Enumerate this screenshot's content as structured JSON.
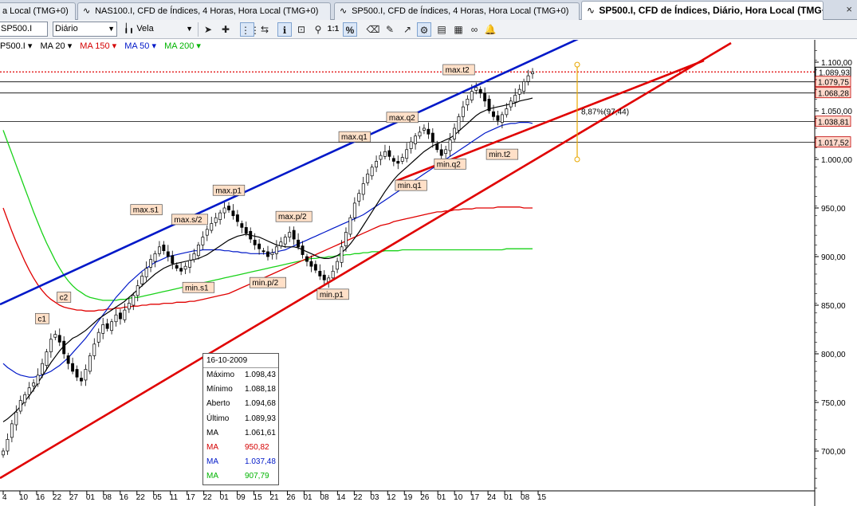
{
  "tabs": [
    {
      "label": "a Local (TMG+0)",
      "active": false
    },
    {
      "label": "NAS100.I, CFD de Índices, 4 Horas, Hora Local (TMG+0)",
      "active": false
    },
    {
      "label": "SP500.I, CFD de Índices, 4 Horas, Hora Local (TMG+0)",
      "active": false
    },
    {
      "label": "SP500.I, CFD de Índices, Diário, Hora Local (TMG+0)",
      "active": true
    }
  ],
  "close_glyph": "×",
  "toolbar": {
    "symbol": "SP500.I",
    "timeframe": "Diário",
    "chart_type": "Vela",
    "icons": [
      "cursor-icon",
      "crosshair-icon",
      "grid-icon",
      "auto-scroll-icon",
      "info-icon",
      "zoom-box-icon",
      "zoom-icon",
      "zoom-reset-icon",
      "percent-icon",
      "eraser-icon",
      "draw-icon",
      "magnet-icon",
      "indicator-icon",
      "template-icon",
      "link-icon",
      "alert-icon"
    ],
    "reset_label": "1:1",
    "percent_label": "%"
  },
  "indicators": [
    {
      "label": "P500.I ▾",
      "color": "#000000"
    },
    {
      "label": "MA 20 ▾",
      "color": "#000000"
    },
    {
      "label": "MA 150 ▾",
      "color": "#d40000"
    },
    {
      "label": "MA 50 ▾",
      "color": "#0018c8"
    },
    {
      "label": "MA 200 ▾",
      "color": "#00b400"
    }
  ],
  "colors": {
    "ma20": "#000000",
    "ma150": "#e00000",
    "ma50": "#0018c8",
    "ma200": "#19d219",
    "channel_top": "#0018c8",
    "channel_bottom": "#e00000",
    "candle_up": "#ffffff",
    "candle_down": "#000000",
    "price_tag_bg": "#ffd9cc",
    "price_tag_text": "#c00000",
    "annot_bg": "#ffe0c8",
    "measure": "#e8a800"
  },
  "chart_data": {
    "type": "candlestick",
    "title": "",
    "y_ticks": [
      "1.100,00",
      "1.050,00",
      "1.000,00",
      "950,00",
      "900,00",
      "850,00",
      "800,00",
      "750,00",
      "700,00"
    ],
    "y_tick_values": [
      1100,
      1050,
      1000,
      950,
      900,
      850,
      800,
      750,
      700
    ],
    "ylim": [
      662,
      1118
    ],
    "x_ticks": [
      "4",
      "10",
      "16",
      "22",
      "27",
      "01",
      "08",
      "16",
      "22",
      "05",
      "11",
      "17",
      "22",
      "01",
      "09",
      "15",
      "21",
      "26",
      "01",
      "08",
      "14",
      "22",
      "03",
      "12",
      "19",
      "26",
      "01",
      "10",
      "17",
      "24",
      "01",
      "08",
      "15"
    ],
    "price_levels": [
      {
        "value": 1089.93,
        "label": "1.089,93",
        "style": "dotted",
        "current": true
      },
      {
        "value": 1079.75,
        "label": "1.079,75"
      },
      {
        "value": 1068.28,
        "label": "1.068,28"
      },
      {
        "value": 1038.81,
        "label": "1.038,81"
      },
      {
        "value": 1017.52,
        "label": "1.017,52"
      }
    ],
    "annotations": [
      {
        "text": "c1",
        "x_index": 9,
        "value": 835
      },
      {
        "text": "c2",
        "x_index": 14,
        "value": 857
      },
      {
        "text": "max.s1",
        "x_index": 33,
        "value": 947
      },
      {
        "text": "max.s/2",
        "x_index": 43,
        "value": 937
      },
      {
        "text": "max.p1",
        "x_index": 52,
        "value": 967
      },
      {
        "text": "max.p/2",
        "x_index": 67,
        "value": 940
      },
      {
        "text": "min.s1",
        "x_index": 45,
        "value": 867
      },
      {
        "text": "min.p/2",
        "x_index": 61,
        "value": 872
      },
      {
        "text": "min.p1",
        "x_index": 76,
        "value": 860
      },
      {
        "text": "max.q1",
        "x_index": 81,
        "value": 1022
      },
      {
        "text": "max.q2",
        "x_index": 92,
        "value": 1042
      },
      {
        "text": "max.t2",
        "x_index": 105,
        "value": 1091
      },
      {
        "text": "min.q1",
        "x_index": 94,
        "value": 972
      },
      {
        "text": "min.q2",
        "x_index": 103,
        "value": 994
      },
      {
        "text": "min.t2",
        "x_index": 115,
        "value": 1004
      }
    ],
    "measure": {
      "label": "8,87%(97,44)",
      "from": 1000,
      "to": 1097.44
    },
    "candles_close": [
      700,
      712,
      728,
      740,
      752,
      758,
      765,
      770,
      778,
      790,
      802,
      815,
      820,
      812,
      800,
      790,
      782,
      776,
      772,
      784,
      798,
      810,
      822,
      830,
      826,
      833,
      840,
      836,
      845,
      852,
      860,
      870,
      880,
      888,
      897,
      903,
      910,
      906,
      900,
      893,
      888,
      885,
      890,
      896,
      903,
      912,
      920,
      928,
      934,
      940,
      945,
      950,
      948,
      942,
      936,
      930,
      924,
      918,
      912,
      908,
      905,
      900,
      904,
      910,
      915,
      920,
      925,
      918,
      910,
      902,
      895,
      890,
      886,
      880,
      876,
      878,
      885,
      895,
      910,
      925,
      940,
      955,
      965,
      975,
      985,
      992,
      998,
      1004,
      1008,
      1003,
      998,
      996,
      1002,
      1010,
      1018,
      1024,
      1028,
      1032,
      1026,
      1018,
      1010,
      1004,
      1010,
      1020,
      1032,
      1044,
      1054,
      1062,
      1070,
      1074,
      1068,
      1060,
      1050,
      1044,
      1040,
      1046,
      1052,
      1060,
      1066,
      1072,
      1080,
      1086,
      1090
    ],
    "ma20": [
      730,
      733,
      737,
      741,
      746,
      751,
      757,
      763,
      770,
      777,
      784,
      791,
      797,
      803,
      808,
      812,
      816,
      818,
      821,
      824,
      828,
      832,
      836,
      839,
      842,
      845,
      848,
      851,
      854,
      858,
      862,
      866,
      870,
      874,
      878,
      882,
      885,
      888,
      890,
      892,
      893,
      894,
      895,
      896,
      897,
      898,
      900,
      902,
      905,
      908,
      911,
      914,
      917,
      919,
      921,
      922,
      923,
      922,
      921,
      920,
      918,
      916,
      914,
      912,
      911,
      910,
      910,
      910,
      909,
      907,
      905,
      903,
      901,
      899,
      898,
      898,
      899,
      901,
      904,
      908,
      913,
      919,
      925,
      932,
      939,
      946,
      953,
      960,
      967,
      973,
      979,
      984,
      988,
      992,
      996,
      1000,
      1004,
      1008,
      1011,
      1014,
      1016,
      1018,
      1020,
      1022,
      1025,
      1029,
      1033,
      1037,
      1041,
      1045,
      1048,
      1050,
      1052,
      1053,
      1054,
      1055,
      1056,
      1057,
      1058,
      1060,
      1061,
      1062,
      1063
    ],
    "ma50": [
      790,
      786,
      783,
      780,
      778,
      777,
      776,
      776,
      777,
      778,
      780,
      782,
      785,
      788,
      792,
      796,
      801,
      806,
      811,
      816,
      822,
      828,
      834,
      840,
      846,
      852,
      858,
      863,
      868,
      873,
      877,
      881,
      885,
      888,
      891,
      894,
      896,
      898,
      900,
      901,
      902,
      903,
      904,
      905,
      906,
      906,
      907,
      907,
      907,
      907,
      907,
      906,
      906,
      905,
      905,
      904,
      904,
      903,
      903,
      903,
      903,
      903,
      904,
      905,
      906,
      907,
      909,
      911,
      913,
      915,
      917,
      919,
      921,
      923,
      925,
      927,
      929,
      931,
      933,
      935,
      937,
      939,
      941,
      943,
      946,
      949,
      952,
      955,
      958,
      961,
      964,
      967,
      970,
      973,
      976,
      979,
      982,
      985,
      988,
      991,
      994,
      997,
      1000,
      1003,
      1006,
      1009,
      1012,
      1015,
      1018,
      1021,
      1024,
      1027,
      1029,
      1031,
      1033,
      1035,
      1036,
      1037,
      1037,
      1038,
      1038,
      1038,
      1037
    ],
    "ma150": [
      950,
      938,
      926,
      915,
      905,
      895,
      886,
      878,
      871,
      865,
      860,
      856,
      853,
      850,
      848,
      847,
      846,
      845,
      845,
      844,
      844,
      844,
      845,
      845,
      846,
      846,
      847,
      847,
      848,
      848,
      849,
      849,
      850,
      850,
      851,
      851,
      851,
      852,
      852,
      852,
      853,
      853,
      853,
      854,
      854,
      855,
      856,
      857,
      858,
      859,
      860,
      861,
      862,
      864,
      866,
      868,
      870,
      872,
      874,
      876,
      878,
      880,
      882,
      884,
      886,
      888,
      890,
      892,
      894,
      896,
      898,
      900,
      902,
      904,
      906,
      908,
      910,
      912,
      914,
      916,
      918,
      920,
      922,
      924,
      926,
      928,
      930,
      932,
      933,
      934,
      936,
      937,
      938,
      939,
      940,
      941,
      942,
      943,
      944,
      945,
      946,
      946,
      947,
      947,
      948,
      948,
      949,
      949,
      949,
      950,
      950,
      950,
      950,
      950,
      951,
      951,
      951,
      951,
      951,
      951,
      950,
      950,
      950
    ],
    "ma200": [
      1030,
      1018,
      1006,
      994,
      982,
      970,
      958,
      946,
      935,
      924,
      914,
      905,
      896,
      888,
      881,
      875,
      870,
      866,
      863,
      860,
      858,
      857,
      856,
      855,
      855,
      855,
      855,
      856,
      856,
      857,
      858,
      858,
      859,
      860,
      861,
      862,
      863,
      864,
      865,
      866,
      867,
      868,
      869,
      870,
      871,
      872,
      873,
      874,
      875,
      876,
      877,
      878,
      879,
      880,
      881,
      882,
      883,
      884,
      885,
      886,
      887,
      888,
      889,
      890,
      891,
      892,
      893,
      894,
      895,
      896,
      897,
      898,
      898,
      899,
      899,
      900,
      900,
      901,
      901,
      902,
      902,
      903,
      903,
      904,
      904,
      905,
      905,
      905,
      906,
      906,
      906,
      906,
      907,
      907,
      907,
      907,
      907,
      907,
      907,
      907,
      907,
      907,
      907,
      907,
      907,
      907,
      907,
      907,
      907,
      907,
      907,
      907,
      907,
      907,
      907,
      907,
      908,
      908,
      908,
      908,
      908,
      908,
      908
    ],
    "crosshair_bar": {
      "date": "16-10-2009",
      "rows": [
        {
          "key": "Máximo",
          "value": "1.098,43",
          "color": "#000000"
        },
        {
          "key": "Mínimo",
          "value": "1.088,18",
          "color": "#000000"
        },
        {
          "key": "Aberto",
          "value": "1.094,68",
          "color": "#000000"
        },
        {
          "key": "Último",
          "value": "1.089,93",
          "color": "#000000"
        },
        {
          "key": "MA",
          "value": "1.061,61",
          "color": "#000000"
        },
        {
          "key": "MA",
          "value": "950,82",
          "color": "#d40000"
        },
        {
          "key": "MA",
          "value": "1.037,48",
          "color": "#0018c8"
        },
        {
          "key": "MA",
          "value": "907,79",
          "color": "#00b400"
        }
      ]
    }
  }
}
